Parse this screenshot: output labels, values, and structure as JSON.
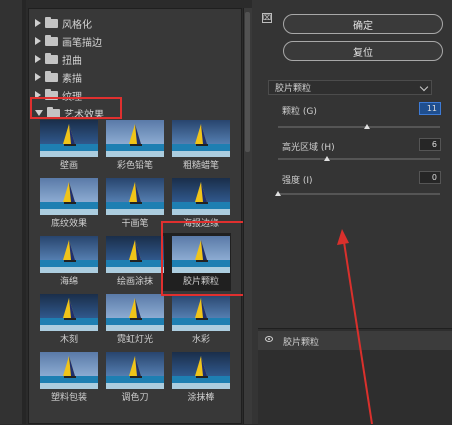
{
  "categories": [
    {
      "label": "风格化",
      "expanded": false
    },
    {
      "label": "画笔描边",
      "expanded": false
    },
    {
      "label": "扭曲",
      "expanded": false
    },
    {
      "label": "素描",
      "expanded": false
    },
    {
      "label": "纹理",
      "expanded": false
    },
    {
      "label": "艺术效果",
      "expanded": true
    }
  ],
  "filters": [
    {
      "label": "壁画"
    },
    {
      "label": "彩色铅笔"
    },
    {
      "label": "粗糙蜡笔"
    },
    {
      "label": "底纹效果"
    },
    {
      "label": "干画笔"
    },
    {
      "label": "海报边缘"
    },
    {
      "label": "海绵"
    },
    {
      "label": "绘画涂抹"
    },
    {
      "label": "胶片颗粒"
    },
    {
      "label": "木刻"
    },
    {
      "label": "霓虹灯光"
    },
    {
      "label": "水彩"
    },
    {
      "label": "塑料包装"
    },
    {
      "label": "调色刀"
    },
    {
      "label": "涂抹棒"
    }
  ],
  "selected_filter": "胶片颗粒",
  "buttons": {
    "ok": "确定",
    "reset": "复位"
  },
  "filter_dropdown": "胶片颗粒",
  "params": [
    {
      "label": "颗粒 (G)",
      "value": "11",
      "slider_fraction": 0.55
    },
    {
      "label": "高光区域 (H)",
      "value": "6",
      "slider_fraction": 0.3
    },
    {
      "label": "强度 (I)",
      "value": "0",
      "slider_fraction": 0.0
    }
  ],
  "layer_label": "胶片颗粒",
  "colors": {
    "highlight_red": "#e0302f",
    "arrow_red": "#d9302c",
    "panel": "#343434"
  }
}
